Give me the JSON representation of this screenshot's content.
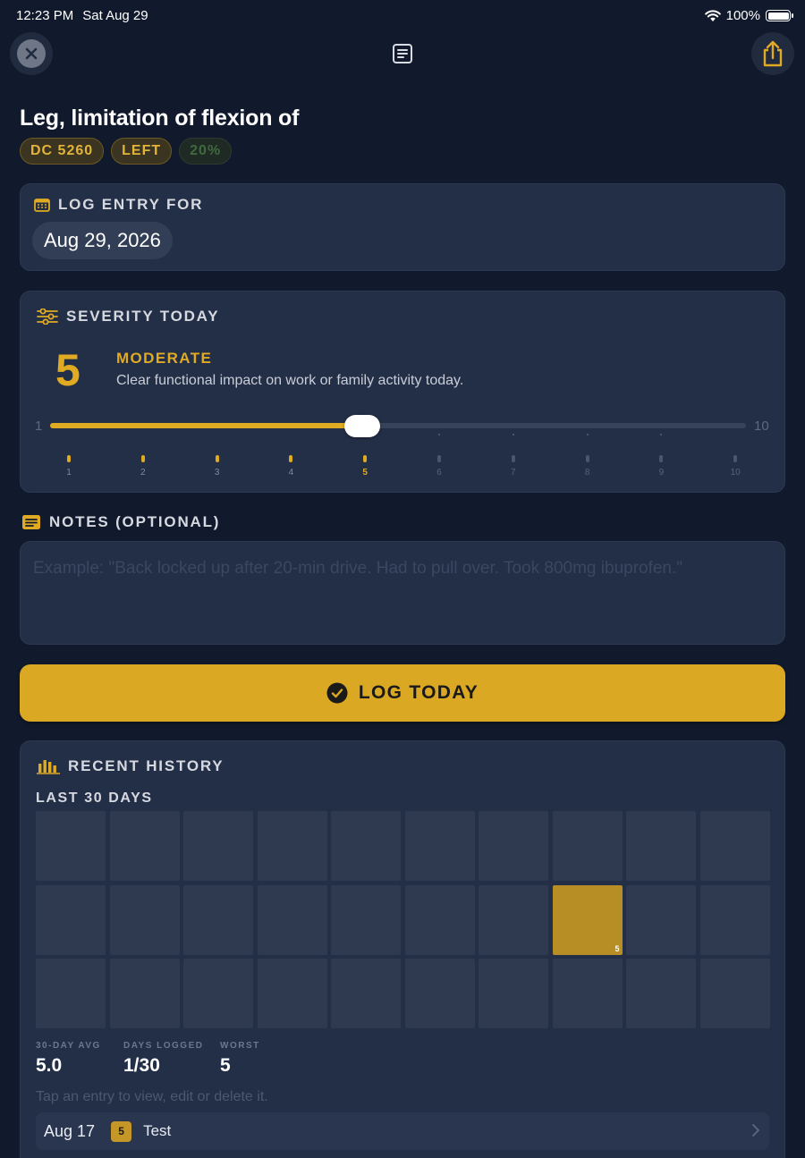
{
  "status_bar": {
    "time": "12:23 PM",
    "date": "Sat Aug 29",
    "battery": "100%"
  },
  "nav": {
    "close_icon": "xmark-circle-icon",
    "center_icon": "note-text-icon",
    "share_icon": "square-and-arrow-up-icon"
  },
  "title": "Leg, limitation of flexion of",
  "badges": {
    "code": "DC 5260",
    "side": "LEFT",
    "rating": "20%"
  },
  "log_entry": {
    "heading": "LOG ENTRY FOR",
    "date": "Aug 29, 2026"
  },
  "severity": {
    "heading": "SEVERITY TODAY",
    "value": "5",
    "level": "MODERATE",
    "description": "Clear functional impact on work or family activity today.",
    "min_label": "1",
    "max_label": "10",
    "current": 5,
    "min": 1,
    "max": 10,
    "ticks": [
      "1",
      "2",
      "3",
      "4",
      "5",
      "6",
      "7",
      "8",
      "9",
      "10"
    ]
  },
  "notes": {
    "heading": "NOTES (OPTIONAL)",
    "placeholder": "Example: \"Back locked up after 20-min drive. Had to pull over. Took 800mg ibuprofen.\""
  },
  "log_button": {
    "label": "LOG TODAY"
  },
  "history": {
    "heading": "RECENT HISTORY",
    "range_label": "LAST 30 DAYS",
    "cells": [
      "",
      "",
      "",
      "",
      "",
      "",
      "",
      "",
      "",
      "",
      "",
      "",
      "",
      "",
      "",
      "",
      "",
      "5",
      "",
      "",
      "",
      "",
      "",
      "",
      "",
      "",
      "",
      "",
      "",
      ""
    ],
    "stats": {
      "avg_label": "30-DAY AVG",
      "avg_value": "5.0",
      "days_label": "DAYS LOGGED",
      "days_value": "1/30",
      "worst_label": "WORST",
      "worst_value": "5"
    },
    "hint": "Tap an entry to view, edit or delete it.",
    "entries": [
      {
        "date": "Aug 17",
        "severity": "5",
        "note": "Test"
      }
    ]
  },
  "colors": {
    "accent": "#dba823",
    "background": "#111a2c",
    "card": "#232f47"
  }
}
